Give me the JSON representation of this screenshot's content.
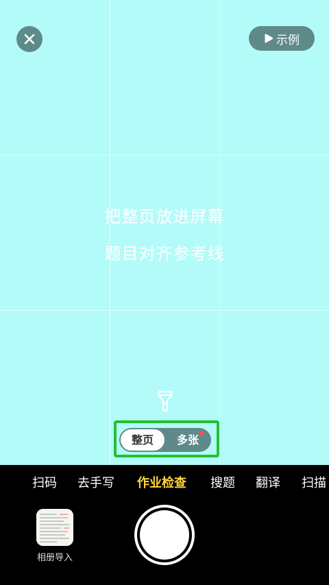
{
  "top": {
    "close_icon": "close-icon",
    "example_label": "示例",
    "example_icon": "play-icon"
  },
  "hints": {
    "line1": "把整页放进屏幕",
    "line2": "题目对齐参考线"
  },
  "flashlight_icon": "flashlight-icon",
  "mode_toggle": {
    "options": [
      "整页",
      "多张"
    ],
    "selected": "整页",
    "badge_color": "#ff4d4d"
  },
  "tabs": [
    {
      "label": "扫码",
      "active": false
    },
    {
      "label": "去手写",
      "active": false
    },
    {
      "label": "作业检查",
      "active": true
    },
    {
      "label": "搜题",
      "active": false
    },
    {
      "label": "翻译",
      "active": false
    },
    {
      "label": "扫描",
      "active": false
    }
  ],
  "album": {
    "label": "相册导入"
  },
  "colors": {
    "viewfinder_bg": "#b3fbf9",
    "active_tab": "#ffd53a",
    "highlight_border": "#22c22b",
    "button_bg": "#5f8a8a"
  }
}
